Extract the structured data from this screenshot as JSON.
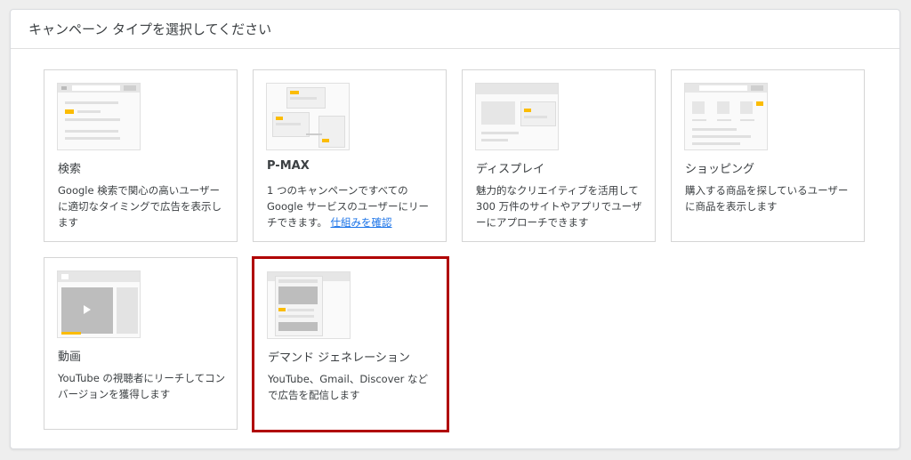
{
  "header": {
    "title": "キャンペーン タイプを選択してください"
  },
  "cards": [
    {
      "title": "検索",
      "desc": "Google 検索で関心の高いユーザーに適切なタイミングで広告を表示します",
      "icon": "search-ad-thumbnail-icon"
    },
    {
      "title": "P-MAX",
      "desc": "1 つのキャンペーンですべての Google サービスのユーザーにリーチできます。",
      "link": "仕組みを確認",
      "icon": "pmax-thumbnail-icon"
    },
    {
      "title": "ディスプレイ",
      "desc": "魅力的なクリエイティブを活用して 300 万件のサイトやアプリでユーザーにアプローチできます",
      "icon": "display-thumbnail-icon"
    },
    {
      "title": "ショッピング",
      "desc": "購入する商品を探しているユーザーに商品を表示します",
      "icon": "shopping-thumbnail-icon"
    },
    {
      "title": "動画",
      "desc": "YouTube の視聴者にリーチしてコンバージョンを獲得します",
      "icon": "video-thumbnail-icon"
    },
    {
      "title": "デマンド ジェネレーション",
      "desc": "YouTube、Gmail、Discover などで広告を配信します",
      "icon": "demand-gen-thumbnail-icon",
      "selected": true
    }
  ],
  "colors": {
    "accent_yellow": "#fbbc04",
    "selection_border": "#b00000",
    "link": "#1a73e8"
  }
}
